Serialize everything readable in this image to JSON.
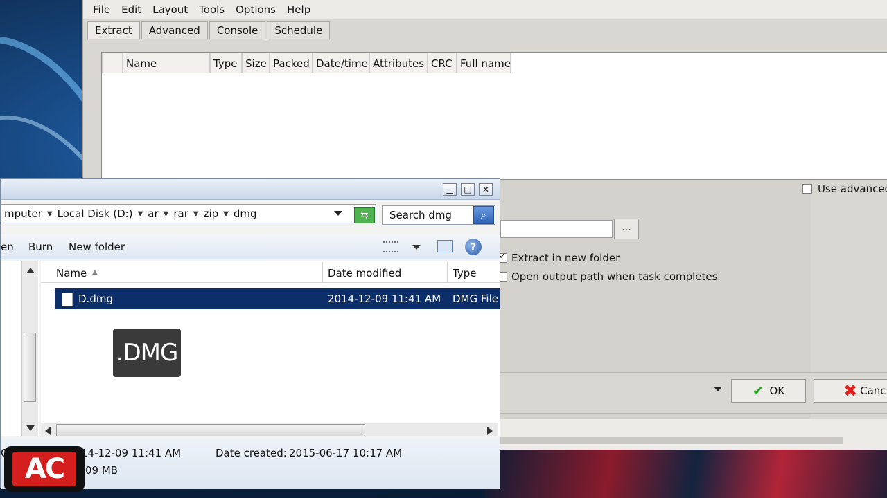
{
  "app": {
    "menu": [
      "File",
      "Edit",
      "Layout",
      "Tools",
      "Options",
      "Help"
    ],
    "tabs": [
      "Extract",
      "Advanced",
      "Console",
      "Schedule"
    ],
    "columns": [
      "Name",
      "Type",
      "Size",
      "Packed",
      "Date/time",
      "Attributes",
      "CRC",
      "Full name"
    ],
    "use_advanced_label": "Use advanced",
    "browse_label": "...",
    "extract_new_folder_label": "Extract in new folder",
    "open_output_label": "Open output path when task completes",
    "ok_label": "OK",
    "cancel_label": "Canc"
  },
  "explorer": {
    "breadcrumb": [
      "mputer",
      "Local Disk (D:)",
      "ar",
      "rar",
      "zip",
      "dmg"
    ],
    "search_placeholder": "Search dmg",
    "toolbar": {
      "open_label": "en",
      "burn_label": "Burn",
      "new_folder_label": "New folder"
    },
    "columns": {
      "name": "Name",
      "date": "Date modified",
      "type": "Type"
    },
    "file": {
      "name": "D.dmg",
      "date": "2014-12-09 11:41 AM",
      "type": "DMG File"
    },
    "overlay_text": ".DMG",
    "details": {
      "left_letter": "O",
      "modified": "14-12-09 11:41 AM",
      "created_label": "Date created:",
      "created_value": "2015-06-17 10:17 AM",
      "size": "09 MB"
    }
  },
  "logo": {
    "text": "AC"
  }
}
